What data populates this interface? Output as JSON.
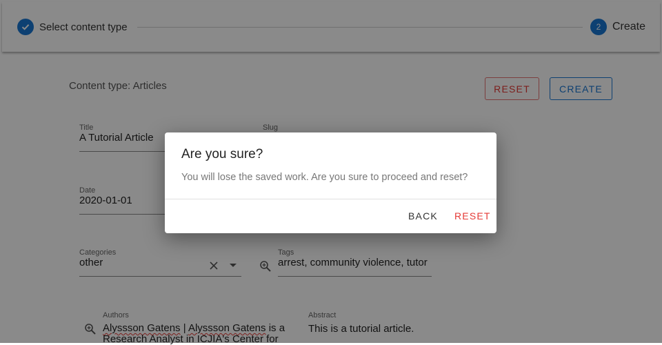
{
  "stepper": {
    "step1": {
      "label": "Select content type",
      "icon": "check-icon"
    },
    "step2": {
      "label": "Create",
      "number": "2"
    }
  },
  "form": {
    "content_type": "Content type: Articles",
    "reset_label": "RESET",
    "create_label": "CREATE",
    "title": {
      "label": "Title",
      "value": "A Tutorial Article"
    },
    "slug": {
      "label": "Slug"
    },
    "date": {
      "label": "Date",
      "value": "2020-01-01"
    },
    "categories": {
      "label": "Categories",
      "value": "other"
    },
    "tags": {
      "label": "Tags",
      "value": "arrest, community violence, tutor"
    },
    "authors": {
      "label": "Authors",
      "name1": "Alyssson Gatens",
      "separator": " | ",
      "name2": "Alyssson Gatens",
      "rest": " is a Research Analyst in ICJIA's Center for"
    },
    "abstract": {
      "label": "Abstract",
      "value": "This is a tutorial article."
    }
  },
  "dialog": {
    "title": "Are you sure?",
    "text": "You will lose the saved work. Are you sure to proceed and reset?",
    "back_label": "BACK",
    "reset_label": "RESET"
  },
  "colors": {
    "primary": "#1976d2",
    "danger": "#e53935",
    "overlay": "rgba(0,0,0,0.46)"
  }
}
